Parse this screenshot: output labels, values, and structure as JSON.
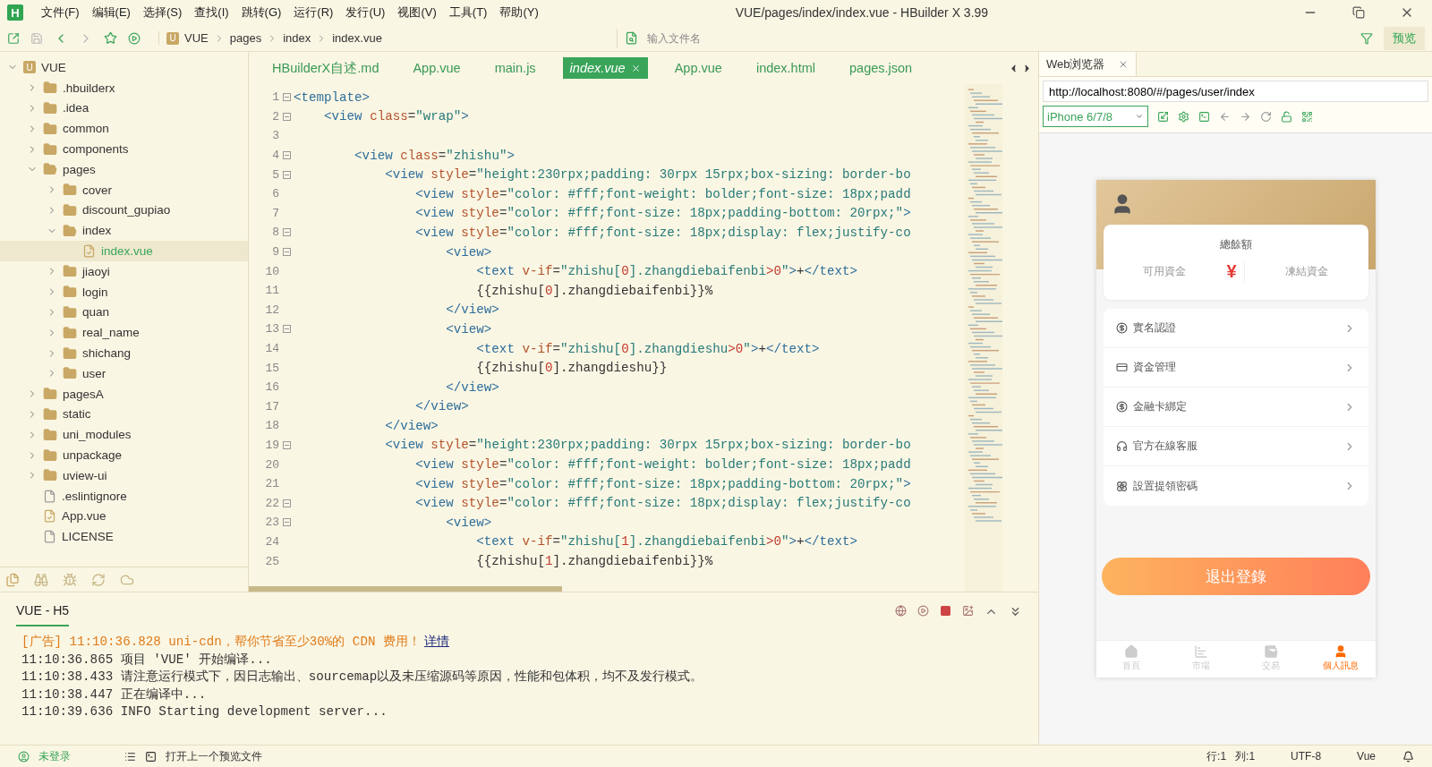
{
  "app_logo": "H",
  "menu": [
    "文件(F)",
    "编辑(E)",
    "选择(S)",
    "查找(I)",
    "跳转(G)",
    "运行(R)",
    "发行(U)",
    "视图(V)",
    "工具(T)",
    "帮助(Y)"
  ],
  "window": {
    "title": "VUE/pages/index/index.vue - HBuilder X 3.99"
  },
  "breadcrumb_badge": "U",
  "breadcrumb": [
    "VUE",
    "pages",
    "index",
    "index.vue"
  ],
  "file_search": {
    "placeholder": "输入文件名"
  },
  "preview_button": "预览",
  "tree": {
    "label": "VUE",
    "kind": "project",
    "badge": "U",
    "expanded": true,
    "selected": false,
    "children": [
      {
        "label": ".hbuilderx",
        "kind": "folder",
        "expanded": false,
        "selected": false
      },
      {
        "label": ".idea",
        "kind": "folder",
        "expanded": false,
        "selected": false
      },
      {
        "label": "common",
        "kind": "folder",
        "expanded": false,
        "selected": false
      },
      {
        "label": "components",
        "kind": "folder",
        "expanded": false,
        "selected": false
      },
      {
        "label": "pages",
        "kind": "folder",
        "expanded": true,
        "selected": false,
        "children": [
          {
            "label": "cover",
            "kind": "folder",
            "expanded": false,
            "selected": false
          },
          {
            "label": "discount_gupiao",
            "kind": "folder",
            "expanded": false,
            "selected": false
          },
          {
            "label": "index",
            "kind": "folder",
            "expanded": true,
            "selected": false,
            "children": [
              {
                "label": "index.vue",
                "kind": "vue",
                "selected": true
              }
            ]
          },
          {
            "label": "jiaoyi",
            "kind": "folder",
            "expanded": false,
            "selected": false
          },
          {
            "label": "login",
            "kind": "folder",
            "expanded": false,
            "selected": false
          },
          {
            "label": "quan",
            "kind": "folder",
            "expanded": false,
            "selected": false
          },
          {
            "label": "real_name",
            "kind": "folder",
            "expanded": false,
            "selected": false
          },
          {
            "label": "shichang",
            "kind": "folder",
            "expanded": false,
            "selected": false
          },
          {
            "label": "user",
            "kind": "folder",
            "expanded": false,
            "selected": false
          }
        ]
      },
      {
        "label": "pagesA",
        "kind": "folder",
        "expanded": false,
        "selected": false
      },
      {
        "label": "static",
        "kind": "folder",
        "expanded": false,
        "selected": false
      },
      {
        "label": "uni_modules",
        "kind": "folder",
        "expanded": false,
        "selected": false
      },
      {
        "label": "unpackage",
        "kind": "folder",
        "expanded": false,
        "selected": false
      },
      {
        "label": "uview-ui",
        "kind": "folder",
        "expanded": false,
        "selected": false
      },
      {
        "label": ".eslintignore",
        "kind": "file",
        "selected": false
      },
      {
        "label": "App.vue",
        "kind": "vue",
        "selected": false
      },
      {
        "label": "LICENSE",
        "kind": "file",
        "selected": false
      }
    ]
  },
  "editor_tabs": [
    {
      "label": "HBuilderX自述.md",
      "selected": false
    },
    {
      "label": "App.vue",
      "selected": false
    },
    {
      "label": "main.js",
      "selected": false
    },
    {
      "label": "index.vue",
      "selected": true
    },
    {
      "label": "App.vue",
      "selected": false
    },
    {
      "label": "index.html",
      "selected": false
    },
    {
      "label": "pages.json",
      "selected": false
    }
  ],
  "code": [
    {
      "num": "1",
      "fold": true,
      "tokens": [
        {
          "kind": "tag",
          "text": "<template>"
        }
      ]
    },
    {
      "num": "2",
      "fold": true,
      "tokens": [
        {
          "kind": "tag",
          "text": "    <view"
        },
        {
          "kind": "attr",
          "text": " class"
        },
        {
          "kind": "punct",
          "text": "="
        },
        {
          "kind": "string",
          "text": "\"wrap\""
        },
        {
          "kind": "tag",
          "text": ">"
        }
      ]
    },
    {
      "num": "3",
      "fold": false
    },
    {
      "num": "4",
      "fold": true,
      "tokens": [
        {
          "kind": "tag",
          "text": "        <view"
        },
        {
          "kind": "attr",
          "text": " class"
        },
        {
          "kind": "punct",
          "text": "="
        },
        {
          "kind": "string",
          "text": "\"zhishu\""
        },
        {
          "kind": "tag",
          "text": ">"
        }
      ]
    },
    {
      "num": "5",
      "fold": true,
      "tokens": [
        {
          "kind": "tag",
          "text": "            <view"
        },
        {
          "kind": "attr",
          "text": " style"
        },
        {
          "kind": "punct",
          "text": "="
        },
        {
          "kind": "string",
          "text": "\"height:230rpx;padding: 30rpx 15rpx;box-sizing: border-bo"
        }
      ]
    },
    {
      "num": "6",
      "fold": false,
      "tokens": [
        {
          "kind": "tag",
          "text": "                <view"
        },
        {
          "kind": "attr",
          "text": " style"
        },
        {
          "kind": "punct",
          "text": "="
        },
        {
          "kind": "string",
          "text": "\"color: #fff;font-weight: bolder;font-size: 18px;padd"
        }
      ]
    },
    {
      "num": "7",
      "fold": false,
      "tokens": [
        {
          "kind": "tag",
          "text": "                <view"
        },
        {
          "kind": "attr",
          "text": " style"
        },
        {
          "kind": "punct",
          "text": "="
        },
        {
          "kind": "string",
          "text": "\"color: #fff;font-size: 18px;padding-bottom: 20rpx;\""
        },
        {
          "kind": "tag",
          "text": ">"
        }
      ]
    },
    {
      "num": "8",
      "fold": true,
      "tokens": [
        {
          "kind": "tag",
          "text": "                <view"
        },
        {
          "kind": "attr",
          "text": " style"
        },
        {
          "kind": "punct",
          "text": "="
        },
        {
          "kind": "string",
          "text": "\"color: #fff;font-size: 18px;display: flex;justify-co"
        }
      ]
    },
    {
      "num": "9",
      "fold": true,
      "tokens": [
        {
          "kind": "tag",
          "text": "                    <view>"
        }
      ]
    },
    {
      "num": "10",
      "fold": false,
      "tokens": [
        {
          "kind": "tag",
          "text": "                        <text"
        },
        {
          "kind": "attr",
          "text": " v-if"
        },
        {
          "kind": "punct",
          "text": "="
        },
        {
          "kind": "string",
          "text": "\"zhishu["
        },
        {
          "kind": "number",
          "text": "0"
        },
        {
          "kind": "string",
          "text": "].zhangdiebaifenbi"
        },
        {
          "kind": "number",
          "text": ">0"
        },
        {
          "kind": "string",
          "text": "\""
        },
        {
          "kind": "tag",
          "text": ">"
        },
        {
          "kind": "plain",
          "text": "+"
        },
        {
          "kind": "tag",
          "text": "</text>"
        }
      ]
    },
    {
      "num": "11",
      "fold": false,
      "tokens": [
        {
          "kind": "plain",
          "text": "                        {{zhishu["
        },
        {
          "kind": "number",
          "text": "0"
        },
        {
          "kind": "plain",
          "text": "].zhangdiebaifenbi}}%"
        }
      ]
    },
    {
      "num": "12",
      "fold": false,
      "tokens": [
        {
          "kind": "tag",
          "text": "                    </view>"
        }
      ]
    },
    {
      "num": "13",
      "fold": true,
      "tokens": [
        {
          "kind": "tag",
          "text": "                    <view>"
        }
      ]
    },
    {
      "num": "14",
      "fold": false,
      "tokens": [
        {
          "kind": "tag",
          "text": "                        <text"
        },
        {
          "kind": "attr",
          "text": " v-if"
        },
        {
          "kind": "punct",
          "text": "="
        },
        {
          "kind": "string",
          "text": "\"zhishu["
        },
        {
          "kind": "number",
          "text": "0"
        },
        {
          "kind": "string",
          "text": "].zhangdieshu"
        },
        {
          "kind": "number",
          "text": ">0"
        },
        {
          "kind": "string",
          "text": "\""
        },
        {
          "kind": "tag",
          "text": ">"
        },
        {
          "kind": "plain",
          "text": "+"
        },
        {
          "kind": "tag",
          "text": "</text>"
        }
      ]
    },
    {
      "num": "15",
      "fold": false,
      "tokens": [
        {
          "kind": "plain",
          "text": "                        {{zhishu["
        },
        {
          "kind": "number",
          "text": "0"
        },
        {
          "kind": "plain",
          "text": "].zhangdieshu}}"
        }
      ]
    },
    {
      "num": "16",
      "fold": false,
      "tokens": [
        {
          "kind": "tag",
          "text": "                    </view>"
        }
      ]
    },
    {
      "num": "17",
      "fold": false,
      "tokens": [
        {
          "kind": "tag",
          "text": "                </view>"
        }
      ]
    },
    {
      "num": "18",
      "fold": false,
      "tokens": [
        {
          "kind": "tag",
          "text": "            </view>"
        }
      ]
    },
    {
      "num": "19",
      "fold": true,
      "tokens": [
        {
          "kind": "tag",
          "text": "            <view"
        },
        {
          "kind": "attr",
          "text": " style"
        },
        {
          "kind": "punct",
          "text": "="
        },
        {
          "kind": "string",
          "text": "\"height:230rpx;padding: 30rpx 15rpx;box-sizing: border-bo"
        }
      ]
    },
    {
      "num": "20",
      "fold": false,
      "tokens": [
        {
          "kind": "tag",
          "text": "                <view"
        },
        {
          "kind": "attr",
          "text": " style"
        },
        {
          "kind": "punct",
          "text": "="
        },
        {
          "kind": "string",
          "text": "\"color: #fff;font-weight: bolder;font-size: 18px;padd"
        }
      ]
    },
    {
      "num": "21",
      "fold": false,
      "tokens": [
        {
          "kind": "tag",
          "text": "                <view"
        },
        {
          "kind": "attr",
          "text": " style"
        },
        {
          "kind": "punct",
          "text": "="
        },
        {
          "kind": "string",
          "text": "\"color: #fff;font-size: 18px;padding-bottom: 20rpx;\""
        },
        {
          "kind": "tag",
          "text": ">"
        }
      ]
    },
    {
      "num": "22",
      "fold": true,
      "tokens": [
        {
          "kind": "tag",
          "text": "                <view"
        },
        {
          "kind": "attr",
          "text": " style"
        },
        {
          "kind": "punct",
          "text": "="
        },
        {
          "kind": "string",
          "text": "\"color: #fff;font-size: 18px;display: flex;justify-co"
        }
      ]
    },
    {
      "num": "23",
      "fold": true,
      "tokens": [
        {
          "kind": "tag",
          "text": "                    <view>"
        }
      ]
    },
    {
      "num": "24",
      "fold": false,
      "tokens": [
        {
          "kind": "tag",
          "text": "                        <text"
        },
        {
          "kind": "attr",
          "text": " v-if"
        },
        {
          "kind": "punct",
          "text": "="
        },
        {
          "kind": "string",
          "text": "\"zhishu["
        },
        {
          "kind": "number",
          "text": "1"
        },
        {
          "kind": "string",
          "text": "].zhangdiebaifenbi"
        },
        {
          "kind": "number",
          "text": ">0"
        },
        {
          "kind": "string",
          "text": "\""
        },
        {
          "kind": "tag",
          "text": ">"
        },
        {
          "kind": "plain",
          "text": "+"
        },
        {
          "kind": "tag",
          "text": "</text>"
        }
      ]
    },
    {
      "num": "25",
      "fold": false,
      "tokens": [
        {
          "kind": "plain",
          "text": "                        {{zhishu["
        },
        {
          "kind": "number",
          "text": "1"
        },
        {
          "kind": "plain",
          "text": "].zhangdiebaifenbi}}%"
        }
      ]
    }
  ],
  "console": {
    "tabs": [
      {
        "label": "VUE - H5",
        "selected": true
      }
    ],
    "lines": [
      {
        "kind": "ad",
        "text": "[广告] 11:10:36.828 uni-cdn，帮你节省至少30%的 CDN 费用！",
        "link": "详情"
      },
      {
        "kind": "log",
        "text": "11:10:36.865 项目 'VUE' 开始编译..."
      },
      {
        "kind": "log",
        "text": "11:10:38.433 请注意运行模式下，因日志输出、sourcemap以及未压缩源码等原因，性能和包体积，均不及发行模式。"
      },
      {
        "kind": "log",
        "text": "11:10:38.447 正在编译中..."
      },
      {
        "kind": "log",
        "text": "11:10:39.636  INFO  Starting development server..."
      }
    ]
  },
  "browser": {
    "tab": "Web浏览器",
    "url": "http://localhost:8080/#/pages/user/index",
    "device": "iPhone 6/7/8",
    "phone": {
      "balance_title": "總餘額",
      "available": "可用資金",
      "currency": "¥",
      "frozen": "凍結資金",
      "menu": [
        {
          "kind": "verify",
          "label": "實名認證"
        },
        {
          "kind": "funds",
          "label": "資金管理"
        },
        {
          "kind": "card",
          "label": "金融卡綁定"
        },
        {
          "kind": "service",
          "label": "官方在線客服"
        },
        {
          "kind": "password",
          "label": "設置提領密碼"
        }
      ],
      "logout": "退出登錄",
      "tabbar": [
        {
          "kind": "home",
          "label": "首頁",
          "selected": false
        },
        {
          "kind": "market",
          "label": "市場",
          "selected": false
        },
        {
          "kind": "trade",
          "label": "交易",
          "selected": false
        },
        {
          "kind": "profile",
          "label": "個人訊息",
          "selected": true
        }
      ]
    }
  },
  "status_bar": {
    "login": "未登录",
    "hint": "打开上一个预览文件",
    "line": "行:1",
    "column": "列:1",
    "encoding": "UTF-8",
    "language": "Vue"
  }
}
